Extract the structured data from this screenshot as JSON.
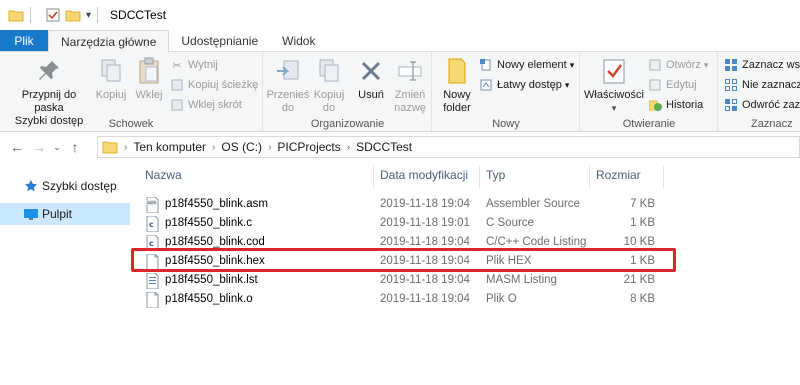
{
  "window": {
    "title": "SDCCTest"
  },
  "tabs": [
    {
      "label": "Plik"
    },
    {
      "label": "Narzędzia główne"
    },
    {
      "label": "Udostępnianie"
    },
    {
      "label": "Widok"
    }
  ],
  "ribbon": {
    "schowek": {
      "label": "Schowek",
      "pin": "Przypnij do paska Szybki dostęp",
      "pin_line1": "Przypnij do paska",
      "pin_line2": "Szybki dostęp",
      "copy": "Kopiuj",
      "paste": "Wklej",
      "cut": "Wytnij",
      "copy_path": "Kopiuj ścieżkę",
      "paste_shortcut": "Wklej skrót"
    },
    "organizowanie": {
      "label": "Organizowanie",
      "move_line1": "Przenieś",
      "move_line2": "do",
      "copyto_line1": "Kopiuj",
      "copyto_line2": "do",
      "delete": "Usuń",
      "rename_line1": "Zmień",
      "rename_line2": "nazwę"
    },
    "nowy": {
      "label": "Nowy",
      "new_folder_line1": "Nowy",
      "new_folder_line2": "folder",
      "new_item": "Nowy element",
      "easy_access": "Łatwy dostęp"
    },
    "otwieranie": {
      "label": "Otwieranie",
      "properties": "Właściwości",
      "open": "Otwórz",
      "edit": "Edytuj",
      "history": "Historia"
    },
    "zaznaczanie": {
      "label": "Zaznacz",
      "select_all": "Zaznacz wszy",
      "select_none": "Nie zaznacza",
      "invert": "Odwróć zazn"
    }
  },
  "address": {
    "crumbs": [
      "Ten komputer",
      "OS (C:)",
      "PICProjects",
      "SDCCTest"
    ]
  },
  "nav": {
    "items": [
      {
        "label": "Szybki dostęp"
      },
      {
        "label": "Pulpit"
      }
    ]
  },
  "list": {
    "headers": {
      "name": "Nazwa",
      "date": "Data modyfikacji",
      "type": "Typ",
      "size": "Rozmiar"
    },
    "files": [
      {
        "name": "p18f4550_blink.asm",
        "date": "2019-11-18 19:04",
        "type": "Assembler Source",
        "size": "7 KB",
        "icon": "asm-file-icon"
      },
      {
        "name": "p18f4550_blink.c",
        "date": "2019-11-18 19:01",
        "type": "C Source",
        "size": "1 KB",
        "icon": "c-file-icon"
      },
      {
        "name": "p18f4550_blink.cod",
        "date": "2019-11-18 19:04",
        "type": "C/C++ Code Listing",
        "size": "10 KB",
        "icon": "cod-file-icon"
      },
      {
        "name": "p18f4550_blink.hex",
        "date": "2019-11-18 19:04",
        "type": "Plik HEX",
        "size": "1 KB",
        "icon": "blank-file-icon"
      },
      {
        "name": "p18f4550_blink.lst",
        "date": "2019-11-18 19:04",
        "type": "MASM Listing",
        "size": "21 KB",
        "icon": "lst-file-icon"
      },
      {
        "name": "p18f4550_blink.o",
        "date": "2019-11-18 19:04",
        "type": "Plik O",
        "size": "8 KB",
        "icon": "blank-file-icon"
      }
    ]
  },
  "colors": {
    "accent": "#1979ca",
    "highlight": "#e0242b",
    "selected": "#cce8ff"
  }
}
